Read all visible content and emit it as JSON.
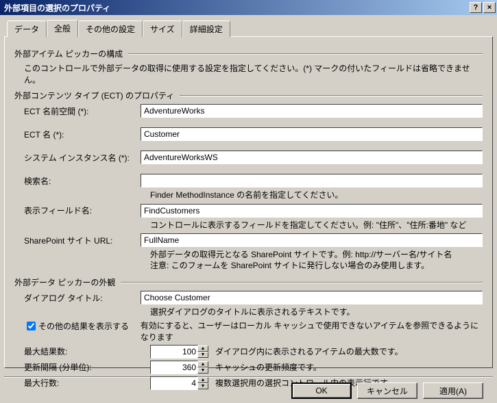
{
  "title": "外部項目の選択のプロパティ",
  "tabs": {
    "data": "データ",
    "general": "全般",
    "other": "その他の設定",
    "size": "サイズ",
    "detail": "詳細設定"
  },
  "group1": {
    "title": "外部アイテム ピッカーの構成",
    "desc": "このコントロールで外部データの取得に使用する設定を指定してください。(*) マークの付いたフィールドは省略できません。"
  },
  "group2": {
    "title": "外部コンテンツ タイプ (ECT) のプロパティ"
  },
  "fields": {
    "ect_ns_label": "ECT 名前空間 (*):",
    "ect_ns": "AdventureWorks",
    "ect_name_label": "ECT 名 (*):",
    "ect_name": "Customer",
    "sys_label": "システム インスタンス名 (*):",
    "sys": "AdventureWorksWS",
    "search_label": "検索名:",
    "search": "",
    "search_hint": "Finder MethodInstance の名前を指定してください。",
    "disp_label": "表示フィールド名:",
    "disp": "FindCustomers",
    "disp_hint": "コントロールに表示するフィールドを指定してください。例: \"住所\"、\"住所:番地\" など",
    "sp_label": "SharePoint サイト URL:",
    "sp": "FullName",
    "sp_hint": "外部データの取得元となる SharePoint サイトです。例: http://サーバー名/サイト名\n注意: このフォームを SharePoint サイトに発行しない場合のみ使用します。"
  },
  "group3": {
    "title": "外部データ ピッカーの外観"
  },
  "dialog": {
    "title_label": "ダイアログ タイトル:",
    "title": "Choose Customer",
    "title_hint": "選択ダイアログのタイトルに表示されるテキストです。",
    "other_label": "その他の結果を表示する",
    "other_checked": true,
    "other_hint": "有効にすると、ユーザーはローカル キャッシュで使用できないアイテムを参照できるようになります",
    "max_label": "最大結果数:",
    "max": "100",
    "max_hint": "ダイアログ内に表示されるアイテムの最大数です。",
    "refresh_label": "更新間隔 (分単位):",
    "refresh": "360",
    "refresh_hint": "キャッシュの更新頻度です。",
    "lines_label": "最大行数:",
    "lines": "4",
    "lines_hint": "複数選択用の選択コントロール内の表示行です。"
  },
  "buttons": {
    "ok": "OK",
    "cancel": "キャンセル",
    "apply": "適用(A)"
  }
}
